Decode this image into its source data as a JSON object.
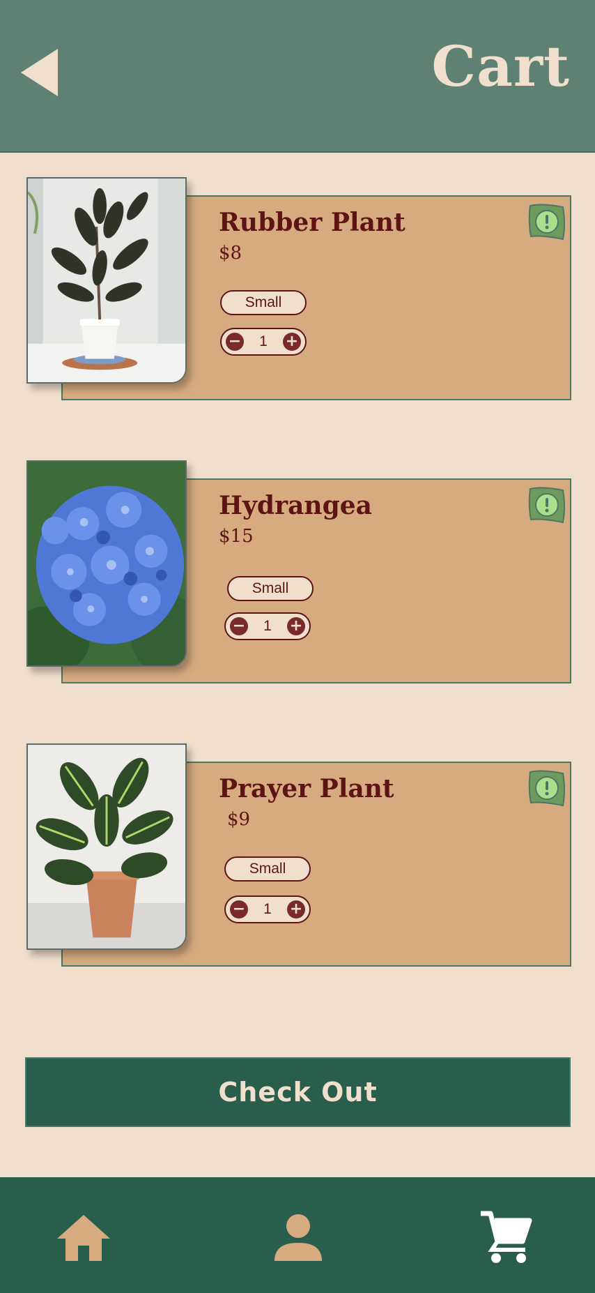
{
  "header": {
    "title": "Cart",
    "back_icon": "back-arrow-icon"
  },
  "items": [
    {
      "name": "Rubber Plant",
      "price": "$8",
      "size": "Small",
      "quantity": "1",
      "image": "rubber-plant-photo"
    },
    {
      "name": "Hydrangea",
      "price": "$15",
      "size": "Small",
      "quantity": "1",
      "image": "hydrangea-photo"
    },
    {
      "name": "Prayer Plant",
      "price": "$9",
      "size": "Small",
      "quantity": "1",
      "image": "prayer-plant-photo"
    }
  ],
  "stepper": {
    "minus": "−",
    "plus": "+"
  },
  "checkout": {
    "label": "Check Out"
  },
  "nav": {
    "items": [
      "home-icon",
      "profile-icon",
      "cart-icon"
    ]
  },
  "colors": {
    "header": "#5f8174",
    "background": "#f0dfcd",
    "card": "#d7ab80",
    "accent_dark": "#2a5e4c",
    "text": "#5e1414",
    "badge": "#6e9a5e"
  }
}
